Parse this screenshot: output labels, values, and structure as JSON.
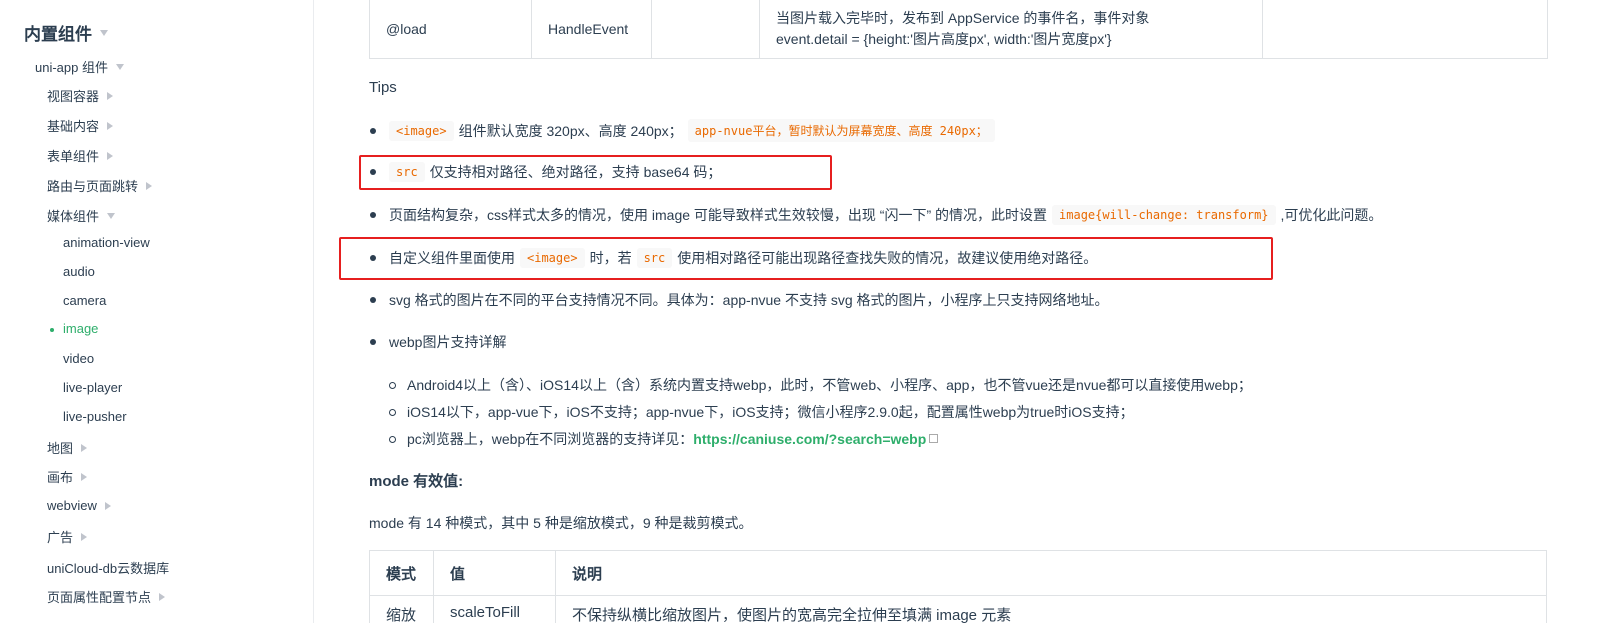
{
  "sidebar": {
    "title": "内置组件",
    "items": [
      {
        "label": "uni-app 组件"
      },
      {
        "label": "视图容器"
      },
      {
        "label": "基础内容"
      },
      {
        "label": "表单组件"
      },
      {
        "label": "路由与页面跳转"
      },
      {
        "label": "媒体组件"
      },
      {
        "label": "animation-view"
      },
      {
        "label": "audio"
      },
      {
        "label": "camera"
      },
      {
        "label": "image"
      },
      {
        "label": "video"
      },
      {
        "label": "live-player"
      },
      {
        "label": "live-pusher"
      },
      {
        "label": "地图"
      },
      {
        "label": "画布"
      },
      {
        "label": "webview"
      },
      {
        "label": "广告"
      },
      {
        "label": "uniCloud-db云数据库"
      },
      {
        "label": "页面属性配置节点"
      }
    ],
    "active": "image"
  },
  "top_table": {
    "event": "@load",
    "type": "HandleEvent",
    "desc_line1": "当图片载入完毕时，发布到 AppService 的事件名，事件对象",
    "desc_line2": "event.detail = {height:'图片高度px', width:'图片宽度px'}"
  },
  "tips": {
    "title": "Tips",
    "item1": {
      "code1": "<image>",
      "text": "组件默认宽度 320px、高度 240px；",
      "code2": "app-nvue平台，暂时默认为屏幕宽度、高度 240px；"
    },
    "item2": {
      "code": "src",
      "text": "仅支持相对路径、绝对路径，支持 base64 码；"
    },
    "item3": {
      "text1": "页面结构复杂，css样式太多的情况，使用 image 可能导致样式生效较慢，出现 “闪一下” 的情况，此时设置",
      "code": "image{will-change: transform}",
      "text2": ",可优化此问题。"
    },
    "item4": {
      "text1": "自定义组件里面使用",
      "code1": "<image>",
      "text2": "时，若",
      "code2": "src",
      "text3": "使用相对路径可能出现路径查找失败的情况，故建议使用绝对路径。"
    },
    "item5": {
      "text": "svg 格式的图片在不同的平台支持情况不同。具体为：app-nvue 不支持 svg 格式的图片，小程序上只支持网络地址。"
    },
    "item6": {
      "text": "webp图片支持详解"
    },
    "sub1": "Android4以上（含）、iOS14以上（含）系统内置支持webp，此时，不管web、小程序、app，也不管vue还是nvue都可以直接使用webp；",
    "sub2": "iOS14以下，app-vue下，iOS不支持；app-nvue下，iOS支持；微信小程序2.9.0起，配置属性webp为true时iOS支持；",
    "sub3_text": "pc浏览器上，webp在不同浏览器的支持详见：",
    "sub3_link": "https://caniuse.com/?search=webp"
  },
  "mode": {
    "heading": "mode 有效值:",
    "para": "mode 有 14 种模式，其中 5 种是缩放模式，9 种是裁剪模式。",
    "headers": [
      "模式",
      "值",
      "说明"
    ],
    "row1": [
      "缩放",
      "scaleToFill",
      "不保持纵横比缩放图片，使图片的宽高完全拉伸至填满 image 元素"
    ]
  }
}
